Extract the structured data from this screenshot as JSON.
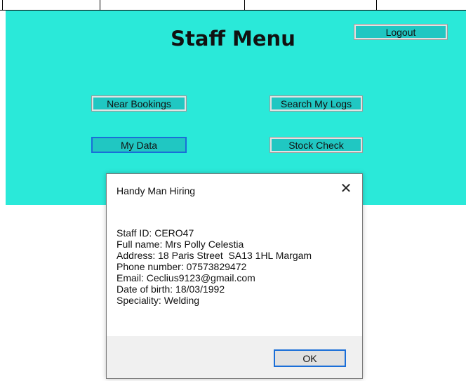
{
  "staff_menu": {
    "title": "Staff Menu",
    "buttons": {
      "logout": "Logout",
      "near_bookings": "Near Bookings",
      "search_my_logs": "Search My Logs",
      "my_data": "My Data",
      "stock_check": "Stock Check"
    },
    "background_color": "#2ae9d9"
  },
  "dialog": {
    "title": "Handy Man Hiring",
    "close_icon": "close-icon",
    "message_lines": [
      "Staff ID: CERO47",
      "Full name: Mrs Polly Celestia",
      "Address: 18 Paris Street  SA13 1HL Margam",
      "Phone number: 07573829472",
      "Email: Ceclius9123@gmail.com",
      "Date of birth: 18/03/1992",
      "Speciality: Welding"
    ],
    "ok_label": "OK"
  }
}
